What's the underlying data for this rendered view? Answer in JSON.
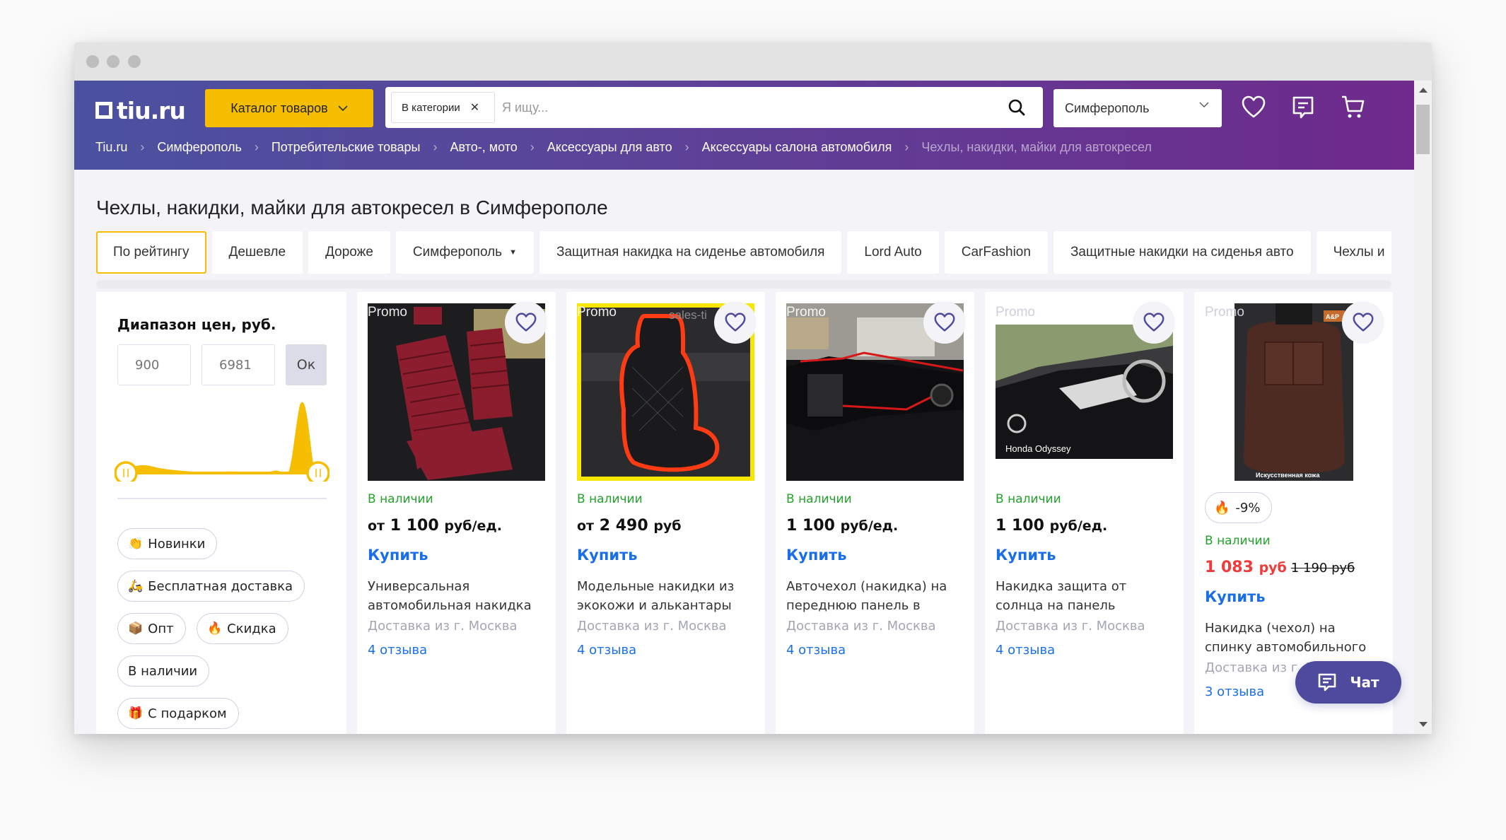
{
  "browser": {
    "window_dots": 3
  },
  "header": {
    "logo_text": "tiu.ru",
    "catalog_label": "Каталог товаров",
    "search": {
      "category_chip": "В категории",
      "placeholder": "Я ищу...",
      "value": ""
    },
    "city": "Симферополь",
    "icons": [
      "heart-icon",
      "messages-icon",
      "cart-icon"
    ],
    "colors": {
      "gradient_start": "#4b51a0",
      "gradient_end": "#6f2a8c",
      "catalog_button": "#f5be00"
    }
  },
  "breadcrumb": [
    {
      "label": "Tiu.ru"
    },
    {
      "label": "Симферополь"
    },
    {
      "label": "Потребительские товары"
    },
    {
      "label": "Авто-, мото"
    },
    {
      "label": "Аксессуары для авто"
    },
    {
      "label": "Аксессуары салона автомобиля"
    },
    {
      "label": "Чехлы, накидки, майки для автокресел"
    }
  ],
  "page_title": "Чехлы, накидки, майки для автокресел в Симферополе",
  "sort_chips": [
    {
      "label": "По рейтингу",
      "active": true
    },
    {
      "label": "Дешевле"
    },
    {
      "label": "Дороже"
    },
    {
      "label": "Симферополь",
      "dropdown": true
    },
    {
      "label": "Защитная накидка на сиденье автомобиля"
    },
    {
      "label": "Lord Auto"
    },
    {
      "label": "CarFashion"
    },
    {
      "label": "Защитные накидки на сиденья авто"
    },
    {
      "label": "Чехлы и"
    }
  ],
  "sidebar": {
    "price_title": "Диапазон цен, руб.",
    "price_min_placeholder": "900",
    "price_max_placeholder": "6981",
    "ok_label": "Ок",
    "price_range": {
      "min": 900,
      "max": 6981
    },
    "tags": [
      {
        "emoji": "👏",
        "label": "Новинки"
      },
      {
        "emoji": "🛵",
        "label": "Бесплатная доставка"
      },
      {
        "emoji": "📦",
        "label": "Опт"
      },
      {
        "emoji": "🔥",
        "label": "Скидка"
      },
      {
        "emoji": "",
        "label": "В наличии"
      },
      {
        "emoji": "🎁",
        "label": "С подарком"
      }
    ]
  },
  "products": [
    {
      "promo": "Promo",
      "stock": "В наличии",
      "price_prefix": "от",
      "price": "1 100",
      "unit": "руб/ед.",
      "buy": "Купить",
      "name": "Универсальная автомобильная накидка на",
      "delivery": "Доставка из г. Москва",
      "reviews": "4 отзыва"
    },
    {
      "promo": "Promo",
      "watermark": "sales-ti",
      "stock": "В наличии",
      "price_prefix": "от",
      "price": "2 490",
      "unit": "руб",
      "buy": "Купить",
      "name": "Модельные накидки из экокожи и алькантары",
      "delivery": "Доставка из г. Москва",
      "reviews": "4 отзыва"
    },
    {
      "promo": "Promo",
      "stock": "В наличии",
      "price_prefix": "",
      "price": "1 100",
      "unit": "руб/ед.",
      "buy": "Купить",
      "name": "Авточехол (накидка) на переднюю панель в",
      "delivery": "Доставка из г. Москва",
      "reviews": "4 отзыва"
    },
    {
      "promo": "Promo",
      "image_caption": "Honda Odyssey",
      "stock": "В наличии",
      "price_prefix": "",
      "price": "1 100",
      "unit": "руб/ед.",
      "buy": "Купить",
      "name": "Накидка защита от солнца на панель приборов",
      "delivery": "Доставка из г. Москва",
      "reviews": "4 отзыва"
    },
    {
      "promo": "Promo",
      "image_caption": "Искусственная кожа",
      "image_badge": "A&P",
      "discount": "-9%",
      "stock": "В наличии",
      "price": "1 083",
      "unit": "руб",
      "old_price": "1 190 руб",
      "buy": "Купить",
      "name": "Накидка (чехол) на спинку автомобильного сиденья с",
      "delivery": "Доставка из г. Москва",
      "reviews": "3 отзыва"
    }
  ],
  "chat": {
    "label": "Чат"
  },
  "colors": {
    "accent_yellow": "#f5be00",
    "link_blue": "#1a6fe8",
    "stock_green": "#22a32a",
    "sale_red": "#f03b3b",
    "chat_purple": "#4e4a9e"
  }
}
